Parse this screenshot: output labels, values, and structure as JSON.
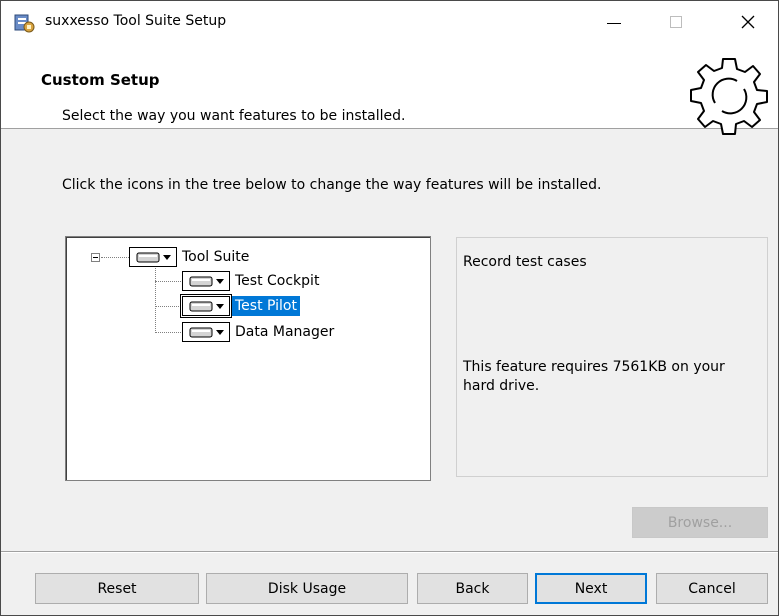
{
  "window": {
    "title": "suxxesso Tool Suite Setup",
    "icon": "installer-icon"
  },
  "banner": {
    "title": "Custom Setup",
    "subtitle": "Select the way you want features to be installed."
  },
  "instruction": "Click the icons in the tree below to change the way features will be installed.",
  "tree": {
    "root": "Tool Suite",
    "children": [
      {
        "label": "Test Cockpit",
        "selected": false
      },
      {
        "label": "Test Pilot",
        "selected": true
      },
      {
        "label": "Data Manager",
        "selected": false
      }
    ]
  },
  "description": {
    "title": "Record test cases",
    "size_text": "This feature requires 7561KB on your hard drive."
  },
  "buttons": {
    "browse": "Browse...",
    "reset": "Reset",
    "disk_usage": "Disk Usage",
    "back": "Back",
    "next": "Next",
    "cancel": "Cancel"
  },
  "colors": {
    "selection": "#0078d7",
    "dialog_bg": "#f0f0f0"
  }
}
